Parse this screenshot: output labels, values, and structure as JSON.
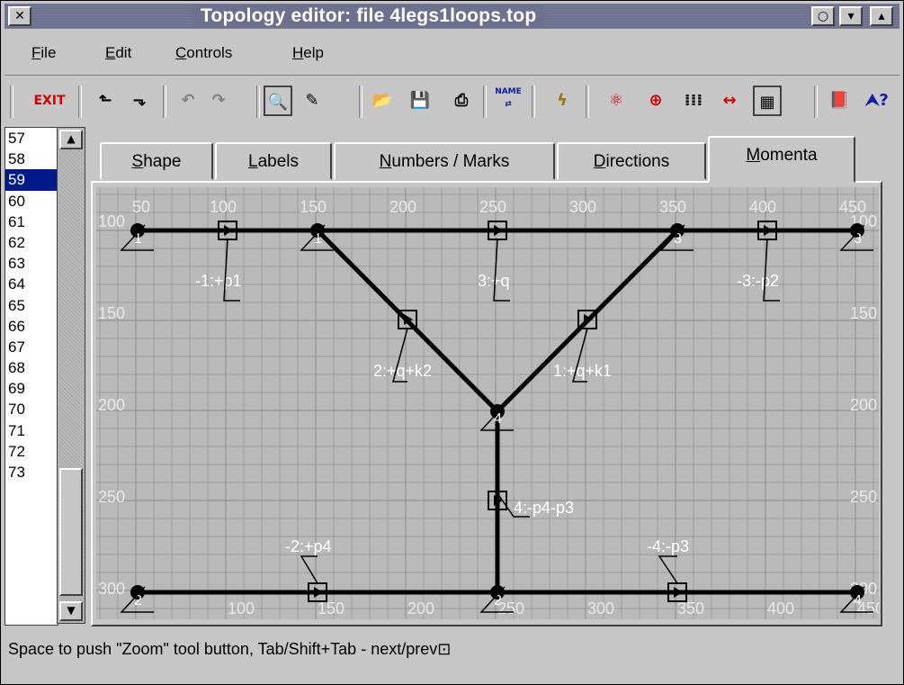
{
  "window": {
    "title": "Topology editor: file 4legs1loops.top",
    "close_glyph": "✕",
    "title_buttons": [
      "○",
      "▾",
      "▴"
    ]
  },
  "menu": {
    "items": [
      {
        "label": "File",
        "mnemonic": "F"
      },
      {
        "label": "Edit",
        "mnemonic": "E"
      },
      {
        "label": "Controls",
        "mnemonic": "C"
      },
      {
        "label": "Help",
        "mnemonic": "H"
      }
    ]
  },
  "toolbar": {
    "exit_label": "EXIT",
    "name_label": "NAME",
    "icons": [
      "exit-icon",
      "arrow-up-left-icon",
      "arrow-down-right-icon",
      "undo-icon",
      "redo-icon",
      "zoom-icon",
      "draw-icon",
      "open-folder-icon",
      "save-icon",
      "print-icon",
      "name-icon",
      "lightning-icon",
      "atom-icon",
      "add-vertex-icon",
      "grid-dots-icon",
      "resize-icon",
      "grid-icon",
      "book-icon",
      "help-icon"
    ]
  },
  "line_numbers": [
    "57",
    "58",
    "59",
    "60",
    "61",
    "62",
    "63",
    "64",
    "65",
    "66",
    "67",
    "68",
    "69",
    "70",
    "71",
    "72",
    "73"
  ],
  "selected_line": "59",
  "tabs": [
    {
      "label": "Shape",
      "underline": "S",
      "active": false
    },
    {
      "label": "Labels",
      "underline": "L",
      "active": false
    },
    {
      "label": "Numbers / Marks",
      "underline": "N",
      "active": false
    },
    {
      "label": "Directions",
      "underline": "D",
      "active": false
    },
    {
      "label": "Momenta",
      "underline": "M",
      "active": true
    }
  ],
  "diagram": {
    "ticks_top": [
      "50",
      "100",
      "150",
      "200",
      "250",
      "300",
      "350",
      "400",
      "450"
    ],
    "ticks_bottom": [
      "100",
      "150",
      "200",
      "250",
      "300",
      "350",
      "400",
      "450"
    ],
    "ticks_left": [
      "100",
      "150",
      "200",
      "250",
      "300"
    ],
    "ticks_right": [
      "100",
      "150",
      "200",
      "250",
      "300"
    ],
    "vertex_labels": [
      "1",
      "1",
      "3",
      "3",
      "4",
      "2",
      "2",
      "4"
    ],
    "momentum_labels": [
      "-1:+p1",
      "3:+q",
      "-3:-p2",
      "2:+q+k2",
      "1:+q+k1",
      "4:-p4-p3",
      "-2:+p4",
      "-4:-p3"
    ]
  },
  "status": "Space to push \"Zoom\" tool button, Tab/Shift+Tab - next/prev⊡"
}
